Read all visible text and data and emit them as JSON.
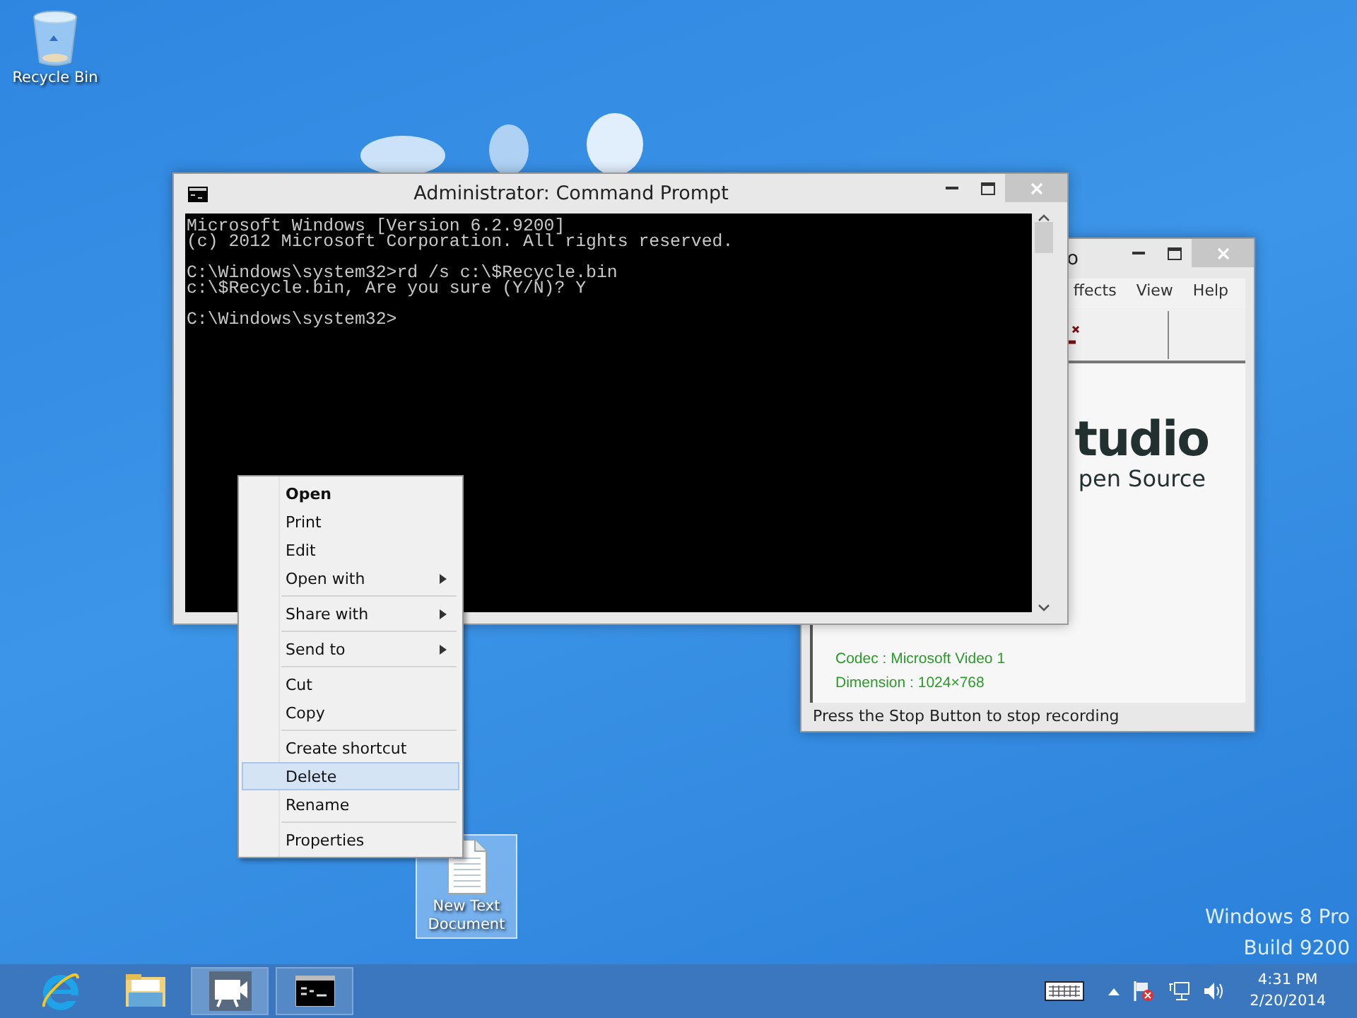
{
  "desktop_icons": [
    {
      "kind": "recycle-bin",
      "label": "Recycle Bin",
      "selected": false
    },
    {
      "kind": "text-file",
      "label": "New Text Document",
      "selected": true
    }
  ],
  "camstudio_window": {
    "title": "o",
    "menu": [
      "ffects",
      "View",
      "Help"
    ],
    "logo_lines": [
      "tudio",
      "pen Source"
    ],
    "info": [
      "Codec : Microsoft Video 1",
      "Dimension : 1024×768"
    ],
    "status": "Press the Stop Button to stop recording"
  },
  "cmd_window": {
    "title": "Administrator: Command Prompt",
    "blocks": [
      [
        "Microsoft Windows [Version 6.2.9200]",
        "(c) 2012 Microsoft Corporation. All rights reserved."
      ],
      [
        "C:\\Windows\\system32>rd /s c:\\$Recycle.bin",
        "c:\\$Recycle.bin, Are you sure (Y/N)? Y"
      ],
      [
        "C:\\Windows\\system32>"
      ]
    ]
  },
  "context_menu": {
    "items": [
      {
        "kind": "item",
        "label": "Open",
        "default": true,
        "submenu": false,
        "selected": false
      },
      {
        "kind": "item",
        "label": "Print",
        "default": false,
        "submenu": false,
        "selected": false
      },
      {
        "kind": "item",
        "label": "Edit",
        "default": false,
        "submenu": false,
        "selected": false
      },
      {
        "kind": "item",
        "label": "Open with",
        "default": false,
        "submenu": true,
        "selected": false
      },
      {
        "kind": "separator"
      },
      {
        "kind": "item",
        "label": "Share with",
        "default": false,
        "submenu": true,
        "selected": false
      },
      {
        "kind": "separator"
      },
      {
        "kind": "item",
        "label": "Send to",
        "default": false,
        "submenu": true,
        "selected": false
      },
      {
        "kind": "separator"
      },
      {
        "kind": "item",
        "label": "Cut",
        "default": false,
        "submenu": false,
        "selected": false
      },
      {
        "kind": "item",
        "label": "Copy",
        "default": false,
        "submenu": false,
        "selected": false
      },
      {
        "kind": "separator"
      },
      {
        "kind": "item",
        "label": "Create shortcut",
        "default": false,
        "submenu": false,
        "selected": false
      },
      {
        "kind": "item",
        "label": "Delete",
        "default": false,
        "submenu": false,
        "selected": true
      },
      {
        "kind": "item",
        "label": "Rename",
        "default": false,
        "submenu": false,
        "selected": false
      },
      {
        "kind": "separator"
      },
      {
        "kind": "item",
        "label": "Properties",
        "default": false,
        "submenu": false,
        "selected": false
      }
    ]
  },
  "edition_text": [
    "Windows 8 Pro",
    "Build 9200"
  ],
  "taskbar": {
    "apps": [
      {
        "kind": "browser",
        "running": false,
        "active": false
      },
      {
        "kind": "folder",
        "running": false,
        "active": false
      },
      {
        "kind": "camera",
        "running": true,
        "active": true
      },
      {
        "kind": "console",
        "running": true,
        "active": false
      }
    ],
    "clock": {
      "time": "4:31 PM",
      "date": "2/20/2014"
    }
  }
}
